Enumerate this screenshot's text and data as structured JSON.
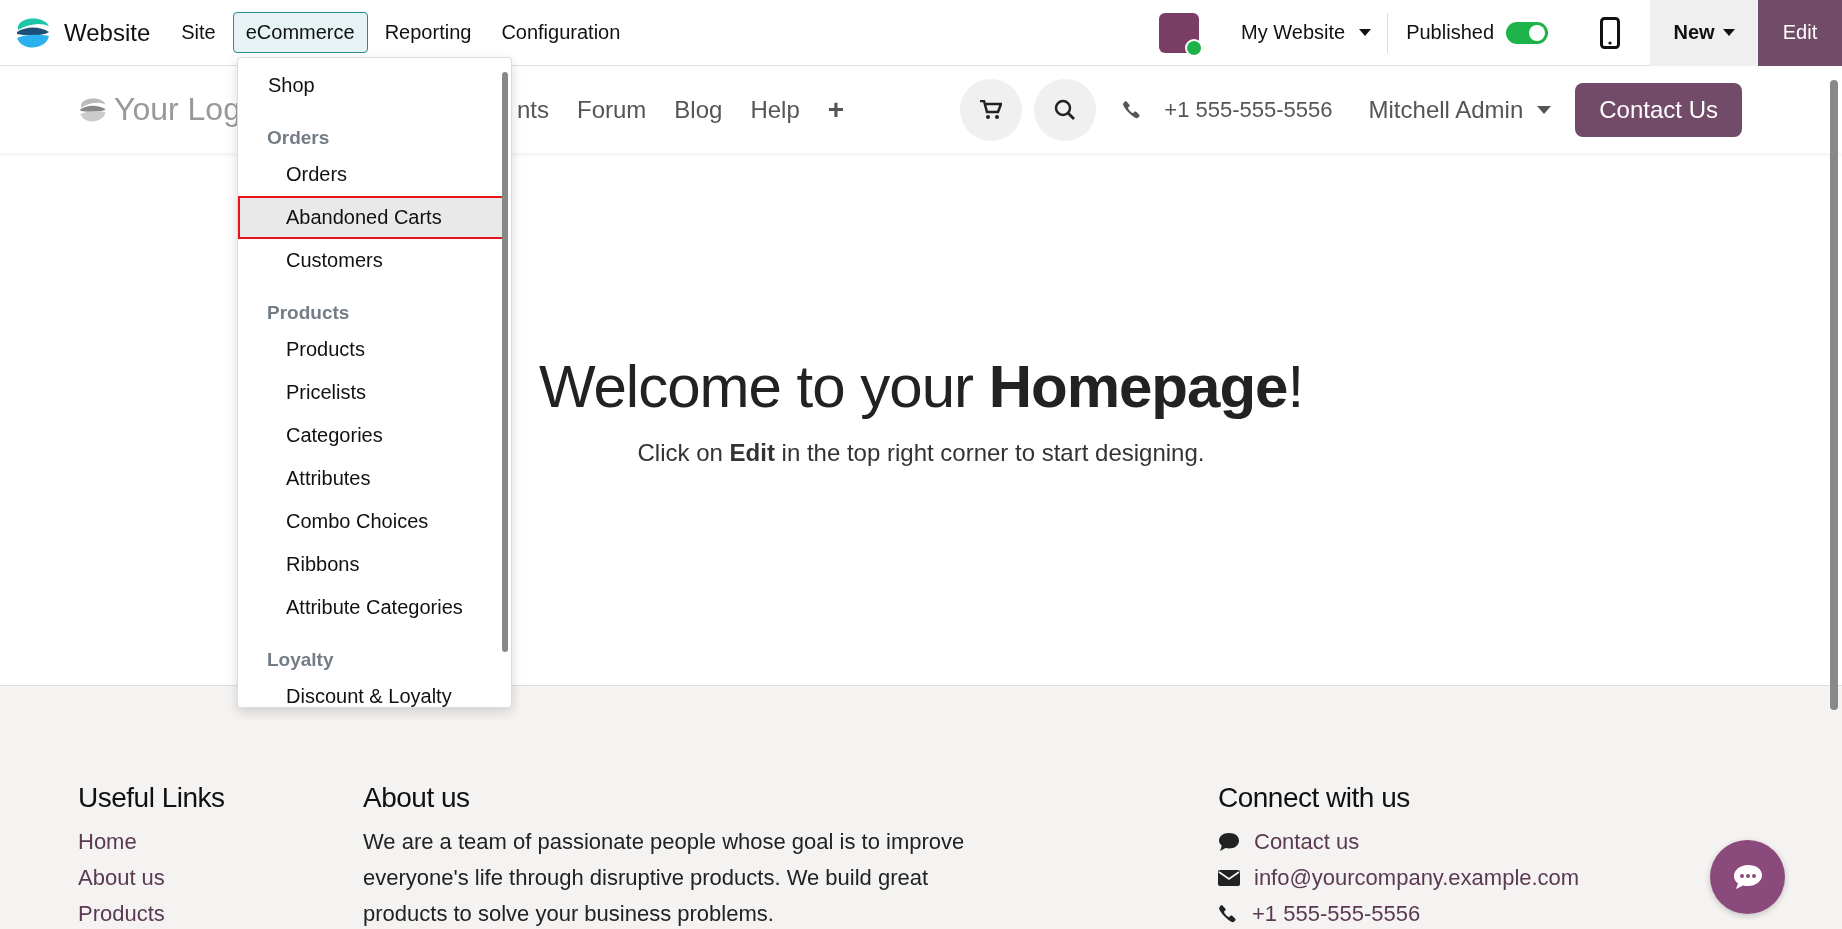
{
  "topbar": {
    "app_name": "Website",
    "menus": [
      {
        "label": "Site",
        "selected": false
      },
      {
        "label": "eCommerce",
        "selected": true
      },
      {
        "label": "Reporting",
        "selected": false
      },
      {
        "label": "Configuration",
        "selected": false
      }
    ],
    "website": "My Website",
    "published": {
      "label": "Published",
      "on": true
    },
    "new_button": "New",
    "edit_button": "Edit"
  },
  "menu": [
    {
      "kind": "item",
      "label": "Shop",
      "selected": false
    },
    {
      "kind": "header",
      "label": "Orders"
    },
    {
      "kind": "item",
      "label": "Orders",
      "selected": false
    },
    {
      "kind": "item",
      "label": "Abandoned Carts",
      "selected": true
    },
    {
      "kind": "item",
      "label": "Customers",
      "selected": false
    },
    {
      "kind": "header",
      "label": "Products"
    },
    {
      "kind": "item",
      "label": "Products",
      "selected": false
    },
    {
      "kind": "item",
      "label": "Pricelists",
      "selected": false
    },
    {
      "kind": "item",
      "label": "Categories",
      "selected": false
    },
    {
      "kind": "item",
      "label": "Attributes",
      "selected": false
    },
    {
      "kind": "item",
      "label": "Combo Choices",
      "selected": false
    },
    {
      "kind": "item",
      "label": "Ribbons",
      "selected": false
    },
    {
      "kind": "item",
      "label": "Attribute Categories",
      "selected": false
    },
    {
      "kind": "header",
      "label": "Loyalty"
    },
    {
      "kind": "item",
      "label": "Discount & Loyalty",
      "selected": false
    }
  ],
  "site_header": {
    "logo": "Your Log",
    "nav": [
      "nts",
      "Forum",
      "Blog",
      "Help",
      "+"
    ],
    "phone": "+1 555-555-5556",
    "user": "Mitchell Admin",
    "contact_button": "Contact Us"
  },
  "hero": {
    "title": "Welcome to your **Homepage**!",
    "subtitle": "Click on **Edit** in the top right corner to start designing."
  },
  "footer": {
    "useful_links": {
      "title": "Useful Links",
      "links": [
        "Home",
        "About us",
        "Products"
      ]
    },
    "about": {
      "title": "About us",
      "text": "We are a team of passionate people whose goal is to improve everyone's life through disruptive products. We build great products to solve your business problems."
    },
    "connect": {
      "title": "Connect with us",
      "items": [
        {
          "kind": "chat",
          "label": "Contact us"
        },
        {
          "kind": "email",
          "label": "info@yourcompany.example.com"
        },
        {
          "kind": "phone",
          "label": "+1 555-555-5556"
        }
      ]
    }
  }
}
